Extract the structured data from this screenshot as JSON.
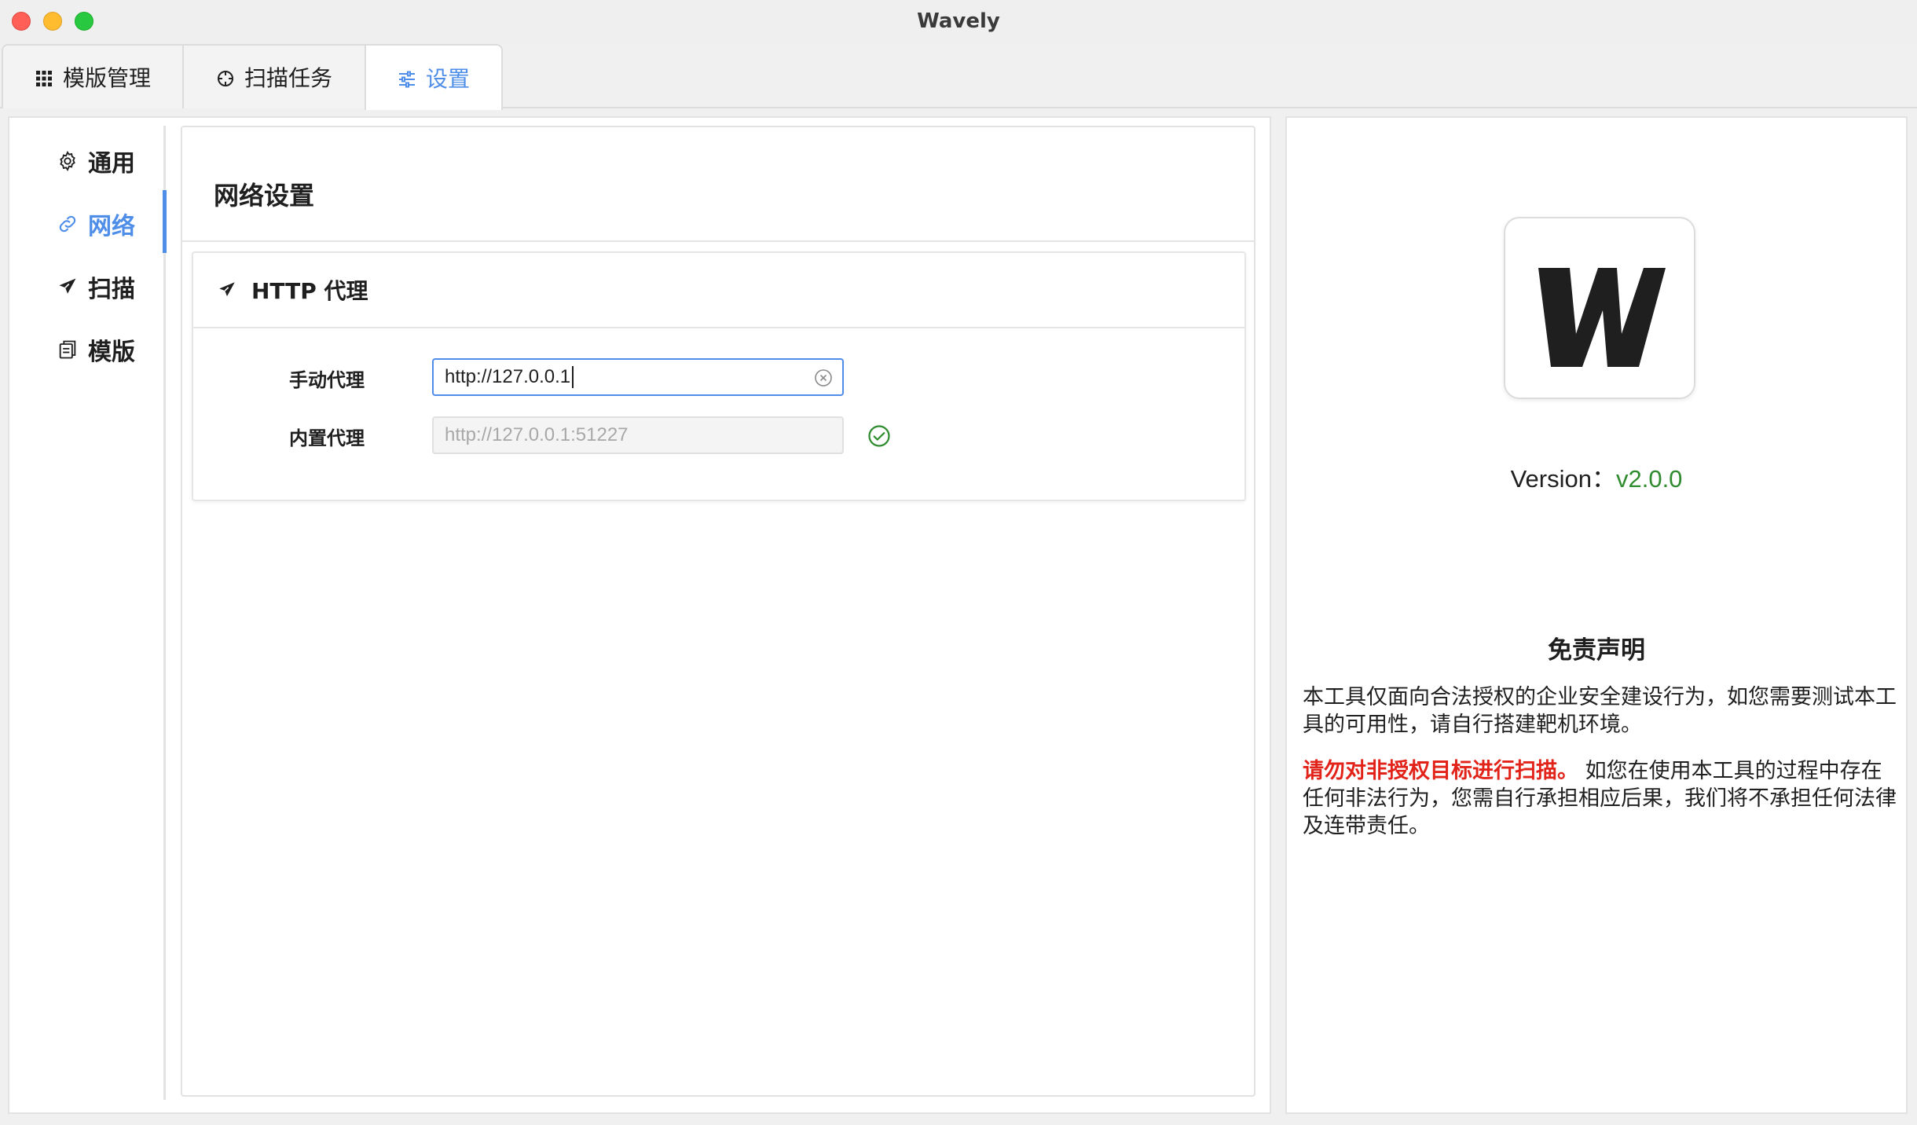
{
  "window": {
    "title": "Wavely"
  },
  "tabs": [
    {
      "label": "模版管理",
      "icon": "grid-icon"
    },
    {
      "label": "扫描任务",
      "icon": "crosshair-icon"
    },
    {
      "label": "设置",
      "icon": "sliders-icon",
      "active": true
    }
  ],
  "sidebar": {
    "items": [
      {
        "label": "通用",
        "icon": "gear-icon"
      },
      {
        "label": "网络",
        "icon": "link-icon",
        "active": true
      },
      {
        "label": "扫描",
        "icon": "send-icon"
      },
      {
        "label": "模版",
        "icon": "copy-icon"
      }
    ]
  },
  "network": {
    "title": "网络设置",
    "http_proxy": {
      "title": "HTTP 代理",
      "manual_label": "手动代理",
      "manual_value": "http://127.0.0.1",
      "builtin_label": "内置代理",
      "builtin_value": "http://127.0.0.1:51227"
    }
  },
  "about": {
    "version_label": "Version：",
    "version": "v2.0.0",
    "disclaimer_title": "免责声明",
    "disclaimer_p1": "本工具仅面向合法授权的企业安全建设行为，如您需要测试本工具的可用性，请自行搭建靶机环境。",
    "disclaimer_warning": "请勿对非授权目标进行扫描。",
    "disclaimer_p2": " 如您在使用本工具的过程中存在任何非法行为，您需自行承担相应后果，我们将不承担任何法律及连带责任。"
  },
  "colors": {
    "accent": "#4e8ee9",
    "version": "#2e8b2e",
    "warning": "#e2231a",
    "success": "#2e8b2e"
  }
}
